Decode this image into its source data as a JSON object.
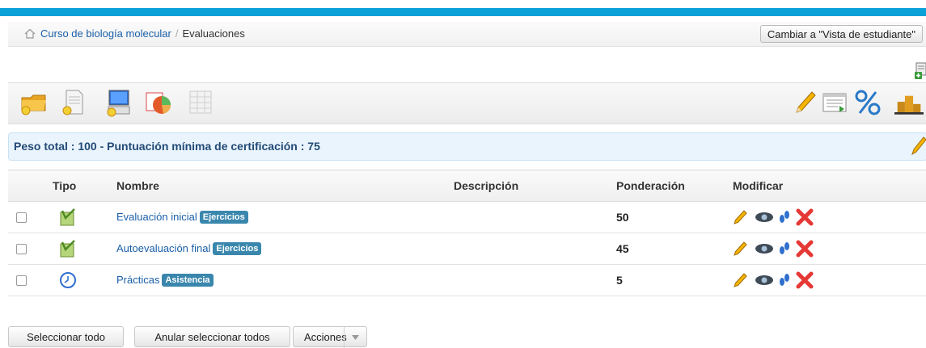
{
  "breadcrumb": {
    "course": "Curso de biología molecular",
    "separator": "/",
    "current": "Evaluaciones"
  },
  "header": {
    "student_view_button": "Cambiar a \"Vista de estudiante\""
  },
  "toolbar": {
    "icons": [
      "folder-new-icon",
      "doc-new-icon",
      "computer-new-icon",
      "pie-chart-icon",
      "grid-icon",
      "pencil-icon",
      "list-view-icon",
      "percent-icon",
      "podium-icon"
    ]
  },
  "summary": {
    "text": "Peso total : 100 - Puntuación mínima de certificación : 75"
  },
  "table": {
    "headers": {
      "tipo": "Tipo",
      "nombre": "Nombre",
      "descripcion": "Descripción",
      "ponderacion": "Ponderación",
      "modificar": "Modificar"
    },
    "rows": [
      {
        "type_icon": "exercise-icon",
        "name": "Evaluación inicial",
        "badge": "Ejercicios",
        "description": "",
        "weight": "50"
      },
      {
        "type_icon": "exercise-icon",
        "name": "Autoevaluación final",
        "badge": "Ejercicios",
        "description": "",
        "weight": "45"
      },
      {
        "type_icon": "clock-icon",
        "name": "Prácticas",
        "badge": "Asistencia",
        "description": "",
        "weight": "5"
      }
    ]
  },
  "footer": {
    "select_all": "Seleccionar todo",
    "unselect_all": "Anular seleccionar todos",
    "actions": "Acciones"
  },
  "colors": {
    "accent_bar": "#0aa0d8",
    "link": "#1a5fa8",
    "badge": "#3a87ad",
    "summary_bg": "#e9f4fc",
    "delete": "#e53935"
  }
}
